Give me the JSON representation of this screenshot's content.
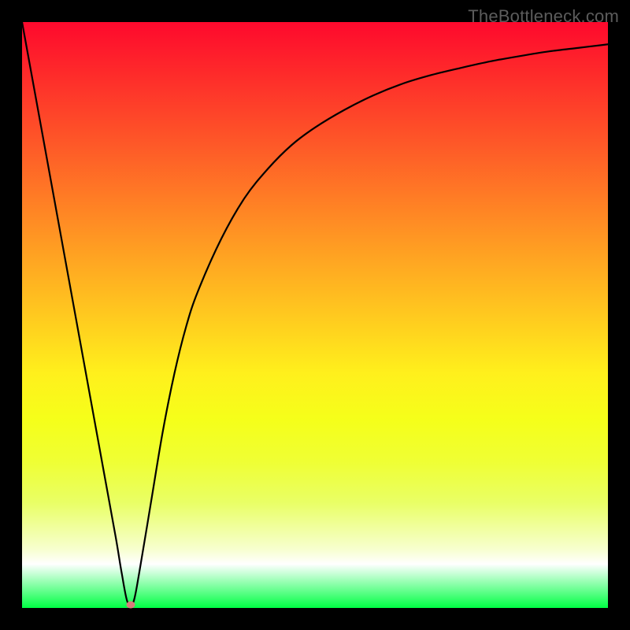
{
  "watermark": "TheBottleneck.com",
  "chart_data": {
    "type": "line",
    "title": "",
    "xlabel": "",
    "ylabel": "",
    "xlim": [
      0,
      100
    ],
    "ylim": [
      0,
      100
    ],
    "grid": false,
    "legend": false,
    "background": "rainbow_gradient_red_top_green_bottom",
    "marker": {
      "x": 18.5,
      "y": 0.5,
      "color": "#d77b7b"
    },
    "series": [
      {
        "name": "bottleneck-curve",
        "color": "#000000",
        "x": [
          0,
          2,
          4,
          6,
          8,
          10,
          12,
          14,
          16,
          17,
          18,
          19,
          20,
          22,
          24,
          26,
          28,
          30,
          34,
          38,
          42,
          46,
          50,
          55,
          60,
          65,
          70,
          75,
          80,
          85,
          90,
          95,
          100
        ],
        "y": [
          100,
          89,
          78,
          67,
          56,
          45,
          34,
          23,
          12,
          6,
          1,
          1,
          6,
          18,
          30,
          40,
          48,
          54,
          63,
          70,
          75,
          79,
          82,
          85,
          87.5,
          89.5,
          91,
          92.2,
          93.3,
          94.2,
          95,
          95.6,
          96.2
        ]
      }
    ],
    "gradient_stops": [
      {
        "pct": 0,
        "color": "#fe092d"
      },
      {
        "pct": 10,
        "color": "#fe2f2a"
      },
      {
        "pct": 20,
        "color": "#fe5528"
      },
      {
        "pct": 30,
        "color": "#ff7c25"
      },
      {
        "pct": 40,
        "color": "#ffa322"
      },
      {
        "pct": 50,
        "color": "#ffc91f"
      },
      {
        "pct": 60,
        "color": "#fff01c"
      },
      {
        "pct": 68,
        "color": "#f5ff1a"
      },
      {
        "pct": 75,
        "color": "#efff34"
      },
      {
        "pct": 82,
        "color": "#e9ff65"
      },
      {
        "pct": 90,
        "color": "#f7ffcf"
      },
      {
        "pct": 92.5,
        "color": "#ffffff"
      },
      {
        "pct": 95,
        "color": "#aaffc0"
      },
      {
        "pct": 97.5,
        "color": "#56ff83"
      },
      {
        "pct": 100,
        "color": "#00ff44"
      }
    ]
  }
}
